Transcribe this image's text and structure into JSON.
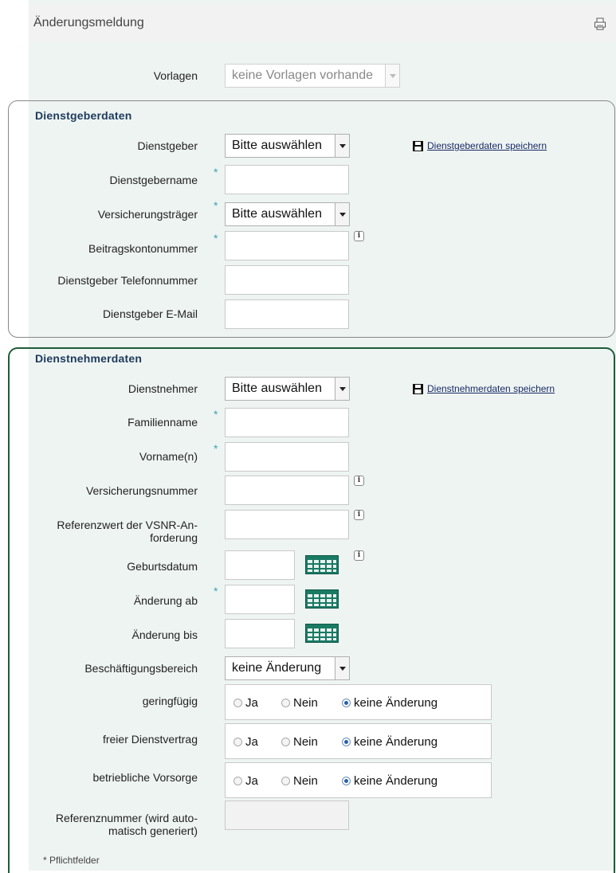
{
  "header": {
    "title": "Änderungsmeldung",
    "print_icon": "print-icon"
  },
  "vorlagen": {
    "label": "Vorlagen",
    "value": "keine Vorlagen vorhande"
  },
  "dienstgeber": {
    "title": "Dienstgeberdaten",
    "save_link": "Dienstgeberdaten speichern",
    "fields": {
      "dienstgeber": {
        "label": "Dienstgeber",
        "value": "Bitte auswählen"
      },
      "name": {
        "label": "Dienstgebername",
        "value": ""
      },
      "traeger": {
        "label": "Versicherungsträger",
        "value": "Bitte auswählen"
      },
      "konto": {
        "label": "Beitragskontonummer",
        "value": ""
      },
      "telefon": {
        "label": "Dienstgeber Telefonnummer",
        "value": ""
      },
      "email": {
        "label": "Dienstgeber E-Mail",
        "value": ""
      }
    }
  },
  "dienstnehmer": {
    "title": "Dienstnehmerdaten",
    "save_link": "Dienstnehmerdaten speichern",
    "fields": {
      "dienstnehmer": {
        "label": "Dienstnehmer",
        "value": "Bitte auswählen"
      },
      "familienname": {
        "label": "Familienname",
        "value": ""
      },
      "vorname": {
        "label": "Vorname(n)",
        "value": ""
      },
      "vsnr": {
        "label": "Versicherungsnummer",
        "value": ""
      },
      "referenzwert": {
        "label_line1": "Referenzwert der VSNR-An-",
        "label_line2": "forderung",
        "value": ""
      },
      "geburtsdatum": {
        "label": "Geburtsdatum",
        "value": ""
      },
      "aenderung_ab": {
        "label": "Änderung ab",
        "value": ""
      },
      "aenderung_bis": {
        "label": "Änderung bis",
        "value": ""
      },
      "beschaeftigung": {
        "label": "Beschäftigungsbereich",
        "value": "keine Änderung"
      },
      "geringfuegig": {
        "label": "geringfügig",
        "selected": "keine Änderung"
      },
      "freier": {
        "label": "freier Dienstvertrag",
        "selected": "keine Änderung"
      },
      "vorsorge": {
        "label": "betriebliche Vorsorge",
        "selected": "keine Änderung"
      },
      "referenznummer": {
        "label_line1": "Referenznummer (wird auto-",
        "label_line2": "matisch generiert)",
        "value": ""
      }
    },
    "radio_options": {
      "ja": "Ja",
      "nein": "Nein",
      "keine": "keine Änderung"
    }
  },
  "required_marker": "*",
  "footnote": "* Pflichtfelder",
  "colors": {
    "panel_bg": "#eef4f2",
    "section_green": "#1f5c3a",
    "required": "#3aa6b0",
    "calendar": "#1a7a64"
  }
}
